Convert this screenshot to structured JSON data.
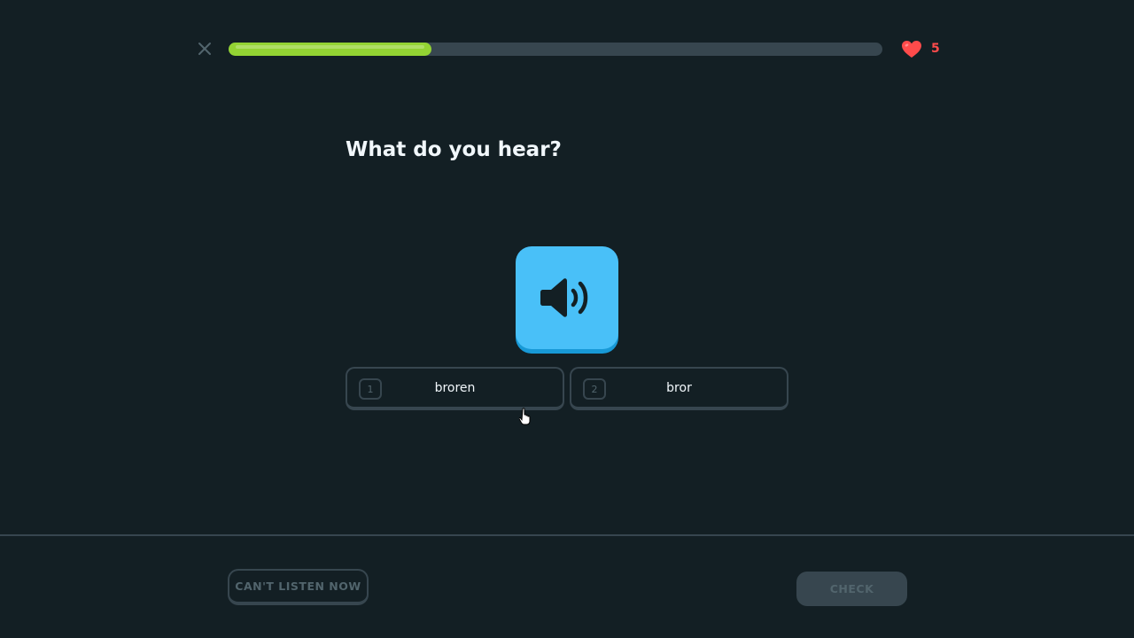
{
  "header": {
    "close_icon": "close-icon",
    "progress_fraction": 0.31,
    "hearts_count": "5",
    "colors": {
      "progress": "#93d333",
      "heart": "#ff4b4b"
    }
  },
  "prompt": {
    "title": "What do you hear?"
  },
  "speaker": {
    "icon": "speaker-icon",
    "color": "#49c0f8"
  },
  "choices": [
    {
      "key": "1",
      "label": "broren"
    },
    {
      "key": "2",
      "label": "bror"
    }
  ],
  "footer": {
    "skip_label": "CAN'T LISTEN NOW",
    "check_label": "CHECK"
  }
}
